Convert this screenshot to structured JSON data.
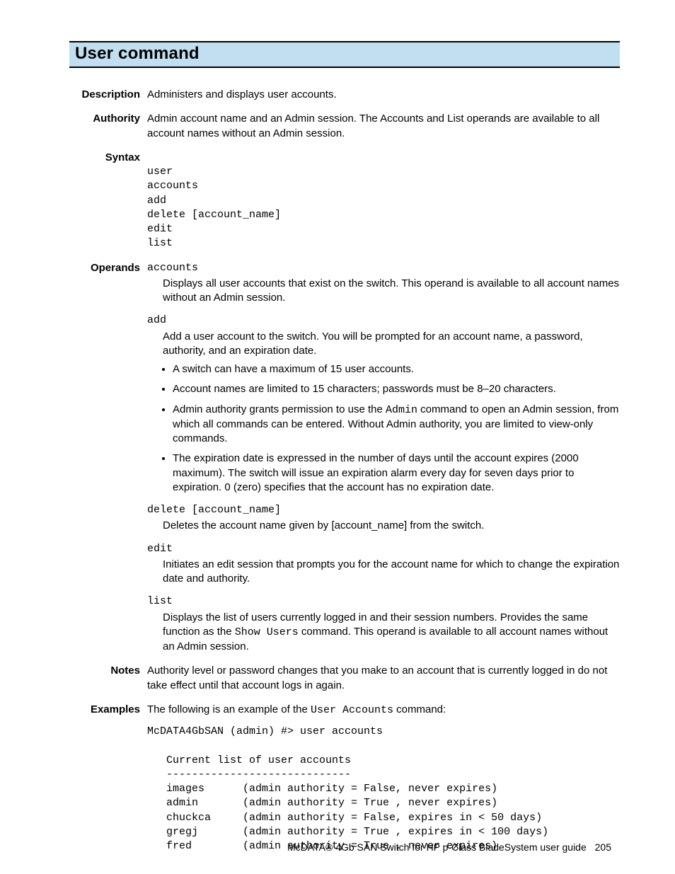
{
  "title": "User command",
  "sections": {
    "description": {
      "label": "Description",
      "text": "Administers and displays user accounts."
    },
    "authority": {
      "label": "Authority",
      "text": "Admin account name and an Admin session. The Accounts and List operands are available to all account names without an Admin session."
    },
    "syntax": {
      "label": "Syntax",
      "lines": [
        "user",
        "accounts",
        "add",
        "delete [account_name]",
        "edit",
        "list"
      ]
    },
    "operands": {
      "label": "Operands",
      "items": [
        {
          "name": "accounts",
          "text": "Displays all user accounts that exist on the switch. This operand is available to all account names without an Admin session."
        },
        {
          "name": "add",
          "text": "Add a user account to the switch. You will be prompted for an account name, a password, authority, and an expiration date.",
          "bullets": [
            "A switch can have a maximum of 15 user accounts.",
            "Account names are limited to 15 characters; passwords must be 8–20 characters.",
            "Admin authority grants permission to use the |Admin| command to open an Admin session, from which all commands can be entered. Without Admin authority, you are limited to view-only commands.",
            "The expiration date is expressed in the number of days until the account expires (2000 maximum). The switch will issue an expiration alarm every day for seven days prior to expiration. 0 (zero) specifies that the account has no expiration date."
          ]
        },
        {
          "name": "delete [account_name]",
          "text": "Deletes the account name given by [account_name] from the switch."
        },
        {
          "name": "edit",
          "text": "Initiates an edit session that prompts you for the account name for which to change the expiration date and authority."
        },
        {
          "name": "list",
          "text_parts": [
            "Displays the list of users currently logged in and their session numbers. Provides the same function as the ",
            "Show Users",
            " command. This operand is available to all account names without an Admin session."
          ]
        }
      ]
    },
    "notes": {
      "label": "Notes",
      "text": "Authority level or password changes that you make to an account that is currently logged in do not take effect until that account logs in again."
    },
    "examples": {
      "label": "Examples",
      "intro_parts": [
        "The following is an example of the ",
        "User Accounts",
        " command:"
      ],
      "code": "McDATA4GbSAN (admin) #> user accounts\n\n   Current list of user accounts\n   -----------------------------\n   images      (admin authority = False, never expires)\n   admin       (admin authority = True , never expires)\n   chuckca     (admin authority = False, expires in < 50 days)\n   gregj       (admin authority = True , expires in < 100 days)\n   fred        (admin authority = True , never expires)"
    }
  },
  "footer": {
    "text": "McDATA® 4Gb SAN Switch for HP p-Class BladeSystem user guide",
    "page": "205"
  }
}
